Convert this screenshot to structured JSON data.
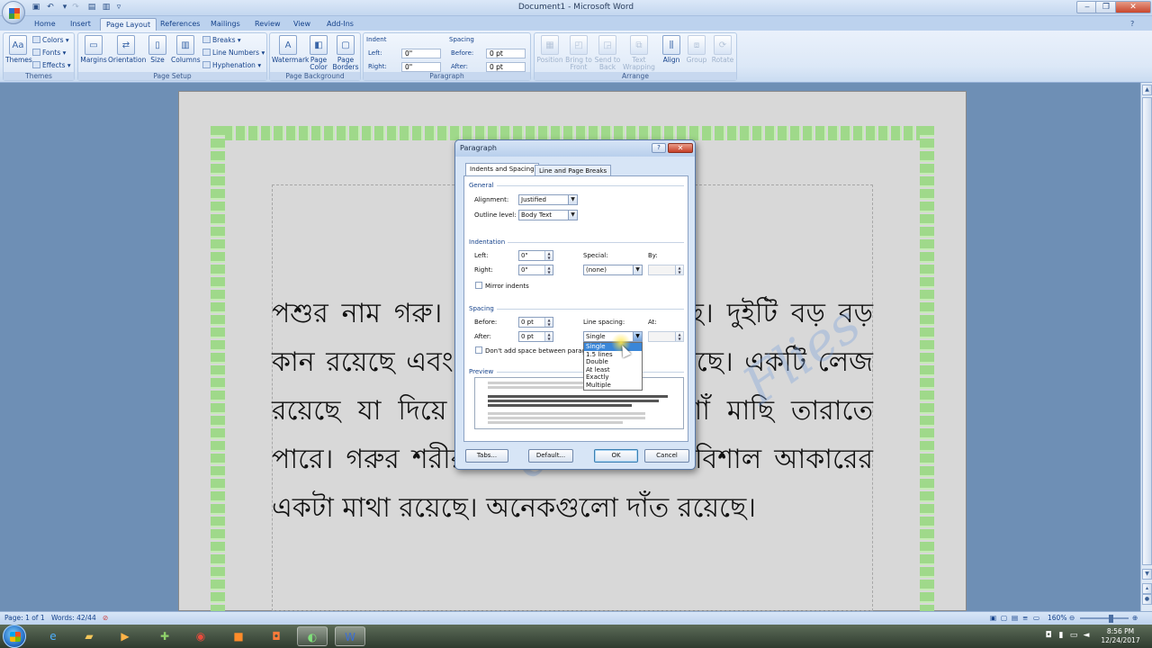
{
  "window": {
    "title": "Document1 - Microsoft Word",
    "qat": {
      "save_icon": "save-icon",
      "undo_icon": "undo-icon",
      "redo_icon": "redo-icon",
      "customize": "▿"
    },
    "controls": {
      "minimize": "‒",
      "maximize": "❐",
      "close": "✕"
    }
  },
  "tabs": [
    "Home",
    "Insert",
    "Page Layout",
    "References",
    "Mailings",
    "Review",
    "View",
    "Add-Ins"
  ],
  "active_tab": "Page Layout",
  "ribbon": {
    "themes": {
      "label": "Themes",
      "themes_btn": "Themes",
      "colors": "Colors",
      "fonts": "Fonts",
      "effects": "Effects"
    },
    "page_setup": {
      "label": "Page Setup",
      "margins": "Margins",
      "orientation": "Orientation",
      "size": "Size",
      "columns": "Columns",
      "breaks": "Breaks",
      "line_numbers": "Line Numbers",
      "hyphenation": "Hyphenation"
    },
    "page_background": {
      "label": "Page Background",
      "watermark": "Watermark",
      "page_color": "Page Color",
      "page_borders": "Page Borders"
    },
    "paragraph": {
      "label": "Paragraph",
      "indent": "Indent",
      "left_label": "Left:",
      "left_value": "0\"",
      "right_label": "Right:",
      "right_value": "0\"",
      "spacing": "Spacing",
      "before_label": "Before:",
      "before_value": "0 pt",
      "after_label": "After:",
      "after_value": "0 pt"
    },
    "arrange": {
      "label": "Arrange",
      "position": "Position",
      "bring_to_front": "Bring to Front",
      "send_to_back": "Send to Back",
      "text_wrapping": "Text Wrapping",
      "align": "Align",
      "group": "Group",
      "rotate": "Rotate"
    }
  },
  "document": {
    "text": "পশুর নাম গরু। গরুর চারটি পা রয়েছে। দুইটি বড় বড় কান রয়েছে এবং দুইটি সুন্দর চোঁখ রয়েছে। একটি লেজ রয়েছে যা দিয়ে সে তার শরীলের মশাঁ মাছি তারাতে পারে। গরুর শরীর অনেক মোটা। তার বিশাল আকারের একটা মাথা রয়েছে। অনেকগুলো দাঁত রয়েছে।",
    "watermark_text": "droid",
    "watermark_text2": "Flies"
  },
  "dialog": {
    "title": "Paragraph",
    "help": "?",
    "close": "✕",
    "tabs": [
      "Indents and Spacing",
      "Line and Page Breaks"
    ],
    "general": {
      "heading": "General",
      "alignment_label": "Alignment:",
      "alignment_value": "Justified",
      "outline_label": "Outline level:",
      "outline_value": "Body Text"
    },
    "indentation": {
      "heading": "Indentation",
      "left_label": "Left:",
      "left_value": "0\"",
      "right_label": "Right:",
      "right_value": "0\"",
      "special_label": "Special:",
      "special_value": "(none)",
      "by_label": "By:",
      "mirror_label": "Mirror indents"
    },
    "spacing": {
      "heading": "Spacing",
      "before_label": "Before:",
      "before_value": "0 pt",
      "after_label": "After:",
      "after_value": "0 pt",
      "line_spacing_label": "Line spacing:",
      "line_spacing_value": "Single",
      "at_label": "At:",
      "dont_add_label": "Don't add space between paragra",
      "options": [
        "Single",
        "1.5 lines",
        "Double",
        "At least",
        "Exactly",
        "Multiple"
      ],
      "selected_option": "Single"
    },
    "preview_heading": "Preview",
    "buttons": {
      "tabs": "Tabs...",
      "default": "Default...",
      "ok": "OK",
      "cancel": "Cancel"
    }
  },
  "statusbar": {
    "page": "Page: 1 of 1",
    "words": "Words: 42/44",
    "zoom": "160%",
    "zoom_minus": "⊖",
    "zoom_plus": "⊕"
  },
  "taskbar": {
    "apps": [
      "internet-explorer-icon",
      "file-explorer-icon",
      "media-player-icon",
      "green-app-icon",
      "chrome-icon",
      "orange-app-icon",
      "powerpoint-icon",
      "green-globe-icon",
      "word-icon"
    ],
    "time": "8:56 PM",
    "date": "12/24/2017"
  }
}
